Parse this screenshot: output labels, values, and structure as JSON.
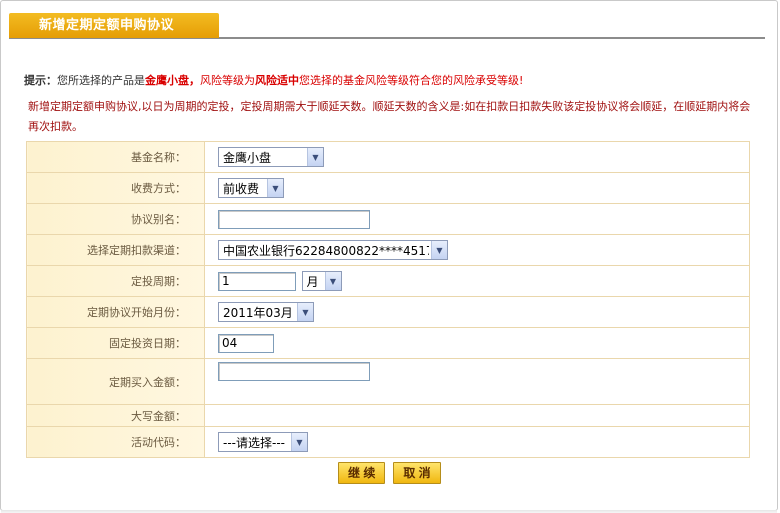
{
  "header": {
    "title": "新增定期定额申购协议"
  },
  "tip": {
    "label": "提示：",
    "text1": "您所选择的产品是",
    "product": "金鹰小盘，",
    "text2": "风险等级为",
    "risk": "风险适中",
    "text3": "您选择的基金风险等级符合您的风险承受等级!"
  },
  "notice": "新增定期定额申购协议,以日为周期的定投，定投周期需大于顺延天数。顺延天数的含义是:如在扣款日扣款失败该定投协议将会顺延，在顺延期内将会再次扣款。",
  "form": {
    "fund_name": {
      "label": "基金名称：",
      "value": "金鹰小盘"
    },
    "fee_method": {
      "label": "收费方式：",
      "value": "前收费"
    },
    "alias": {
      "label": "协议别名：",
      "value": ""
    },
    "channel": {
      "label": "选择定期扣款渠道：",
      "value": "中国农业银行62284800822****4517"
    },
    "period": {
      "label": "定投周期：",
      "value": "1",
      "unit": "月"
    },
    "start_month": {
      "label": "定期协议开始月份：",
      "value": "2011年03月"
    },
    "invest_day": {
      "label": "固定投资日期：",
      "value": "04"
    },
    "amount": {
      "label": "定期买入金额：",
      "value": ""
    },
    "amount_upper": {
      "label": "大写金额：",
      "value": ""
    },
    "activity_code": {
      "label": "活动代码：",
      "value": "---请选择---"
    }
  },
  "buttons": {
    "continue": "继 续",
    "cancel": "取 消"
  },
  "colors": {
    "accent": "#e8a40a",
    "notice": "#a01010",
    "highlight": "#d90000",
    "label_bg": "#fdf2cf"
  },
  "icons": {
    "dropdown": "chevron-down-icon"
  }
}
